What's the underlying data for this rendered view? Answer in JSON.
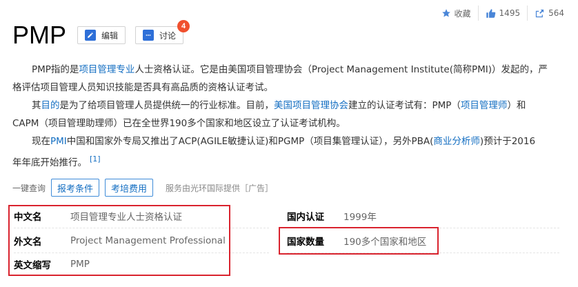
{
  "actions": {
    "favorite_label": "收藏",
    "like_count": "1495",
    "share_count": "564"
  },
  "header": {
    "title": "PMP",
    "edit_label": "编辑",
    "discuss_label": "讨论",
    "discuss_badge": "4"
  },
  "paragraphs": {
    "p1": {
      "l1a": "PMP指的是",
      "l1link": "项目管理专业",
      "l1b": "人士资格认证。它是由美国项目管理协会（Project Management Institute(简称PMI)）发起的，严",
      "l2": "格评估项目管理人员知识技能是否具有高品质的资格认证考试。"
    },
    "p2": {
      "l1a": "其",
      "l1link1": "目的",
      "l1b": "是为了给项目管理人员提供统一的行业标准。目前，",
      "l1link2": "美国项目管理协会",
      "l1c": "建立的认证考试有：PMP（",
      "l1link3": "项目管理师",
      "l1d": "）和",
      "l2": "CAPM（项目管理助理师）已在全世界190多个国家和地区设立了认证考试机构。"
    },
    "p3": {
      "l1a": "现在",
      "l1link1": "PMI",
      "l1b": "中国和国家外专局又推出了ACP(AGILE敏捷认证)和PGMP（项目集管理认证），另外PBA(",
      "l1link2": "商业分析师",
      "l1c": ")预计于2016",
      "l2": "年年底开始推行。",
      "ref": "[1]"
    }
  },
  "query": {
    "label": "一键查询",
    "btn1": "报考条件",
    "btn2": "考培费用",
    "provider": "服务由光环国际提供［广告］"
  },
  "info": {
    "chinese_name_key": "中文名",
    "chinese_name_val": "项目管理专业人士资格认证",
    "foreign_name_key": "外文名",
    "foreign_name_val": "Project Management Professional",
    "abbr_key": "英文缩写",
    "abbr_val": "PMP",
    "domestic_key": "国内认证",
    "domestic_val": "1999年",
    "countries_key": "国家数量",
    "countries_val": "190多个国家和地区"
  },
  "colors": {
    "link": "#136ec2",
    "highlight_box": "#d9232e",
    "badge": "#f0502e"
  }
}
